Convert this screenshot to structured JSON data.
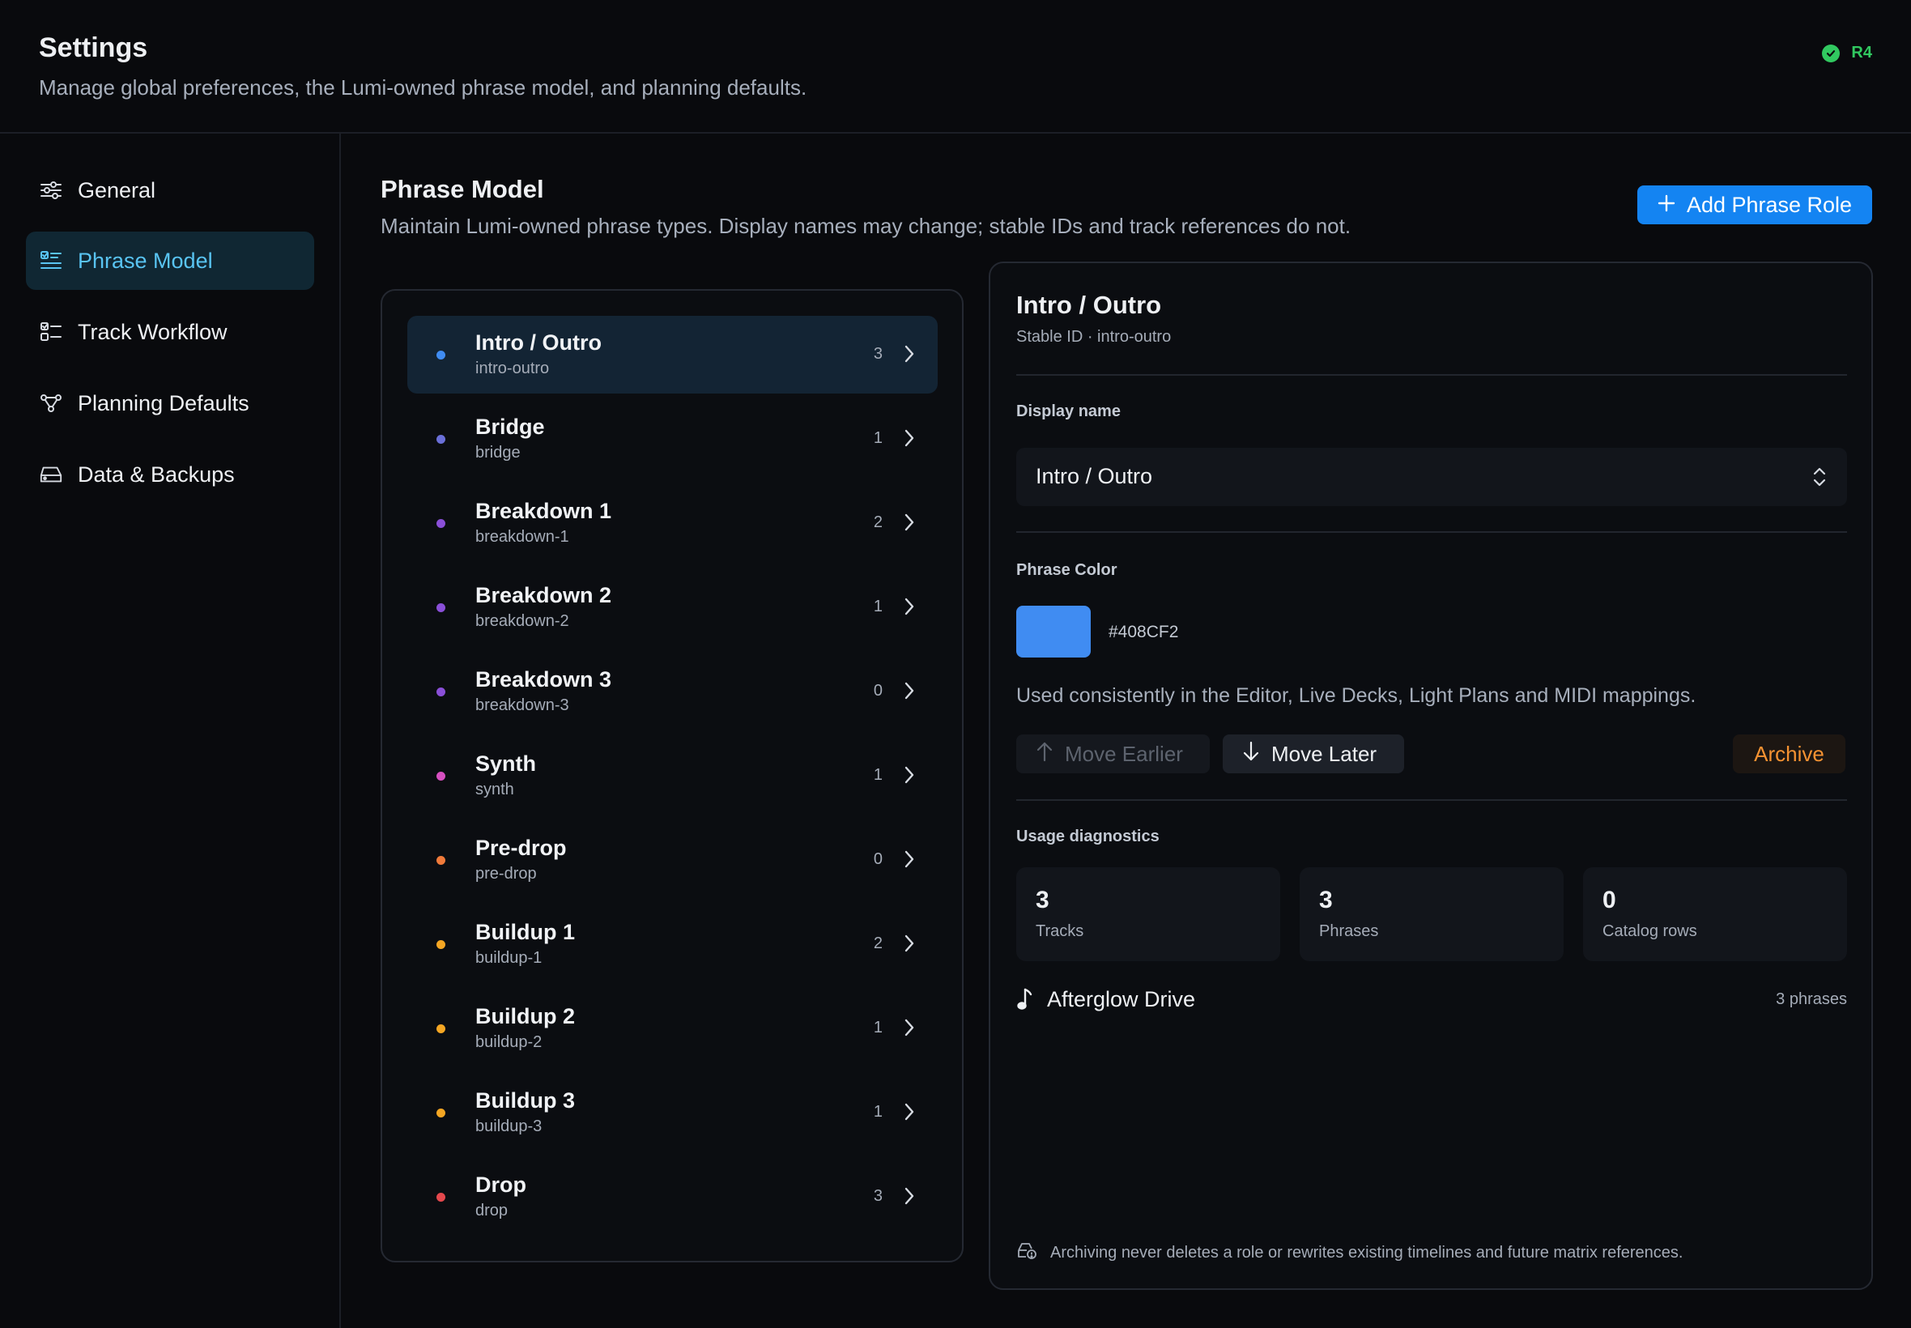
{
  "header": {
    "title": "Settings",
    "subtitle": "Manage global preferences, the Lumi-owned phrase model, and planning defaults.",
    "status_label": "R4",
    "status_color": "#31C960"
  },
  "sidebar": {
    "items": [
      {
        "label": "General",
        "icon": "sliders-icon",
        "active": false
      },
      {
        "label": "Phrase Model",
        "icon": "list-check-icon",
        "active": true
      },
      {
        "label": "Track Workflow",
        "icon": "checklist-icon",
        "active": false
      },
      {
        "label": "Planning Defaults",
        "icon": "nodes-icon",
        "active": false
      },
      {
        "label": "Data & Backups",
        "icon": "drive-icon",
        "active": false
      }
    ]
  },
  "main": {
    "title": "Phrase Model",
    "subtitle": "Maintain Lumi-owned phrase types. Display names may change; stable IDs and track references do not.",
    "add_button_label": "Add Phrase Role"
  },
  "roles": [
    {
      "name": "Intro / Outro",
      "id": "intro-outro",
      "count": "3",
      "color": "#408CF2",
      "selected": true
    },
    {
      "name": "Bridge",
      "id": "bridge",
      "count": "1",
      "color": "#6A6FD8",
      "selected": false
    },
    {
      "name": "Breakdown 1",
      "id": "breakdown-1",
      "count": "2",
      "color": "#8A4FD8",
      "selected": false
    },
    {
      "name": "Breakdown 2",
      "id": "breakdown-2",
      "count": "1",
      "color": "#8A4FD8",
      "selected": false
    },
    {
      "name": "Breakdown 3",
      "id": "breakdown-3",
      "count": "0",
      "color": "#8A4FD8",
      "selected": false
    },
    {
      "name": "Synth",
      "id": "synth",
      "count": "1",
      "color": "#D64FC0",
      "selected": false
    },
    {
      "name": "Pre-drop",
      "id": "pre-drop",
      "count": "0",
      "color": "#F07A3A",
      "selected": false
    },
    {
      "name": "Buildup 1",
      "id": "buildup-1",
      "count": "2",
      "color": "#F5A623",
      "selected": false
    },
    {
      "name": "Buildup 2",
      "id": "buildup-2",
      "count": "1",
      "color": "#F5A623",
      "selected": false
    },
    {
      "name": "Buildup 3",
      "id": "buildup-3",
      "count": "1",
      "color": "#F5A623",
      "selected": false
    },
    {
      "name": "Drop",
      "id": "drop",
      "count": "3",
      "color": "#E5484D",
      "selected": false
    }
  ],
  "detail": {
    "title": "Intro / Outro",
    "stable_id": "Stable ID · intro-outro",
    "display_name_label": "Display name",
    "display_name_value": "Intro / Outro",
    "color_label": "Phrase Color",
    "color_hex": "#408CF2",
    "color_hex_label": "#408CF2",
    "color_note": "Used consistently in the Editor, Live Decks, Light Plans and MIDI mappings.",
    "move_earlier_label": "Move Earlier",
    "move_later_label": "Move Later",
    "archive_label": "Archive",
    "usage_label": "Usage diagnostics",
    "stats": [
      {
        "value": "3",
        "label": "Tracks"
      },
      {
        "value": "3",
        "label": "Phrases"
      },
      {
        "value": "0",
        "label": "Catalog rows"
      }
    ],
    "track": {
      "name": "Afterglow Drive",
      "count": "3 phrases"
    },
    "footer_note": "Archiving never deletes a role or rewrites existing timelines and future matrix references."
  }
}
